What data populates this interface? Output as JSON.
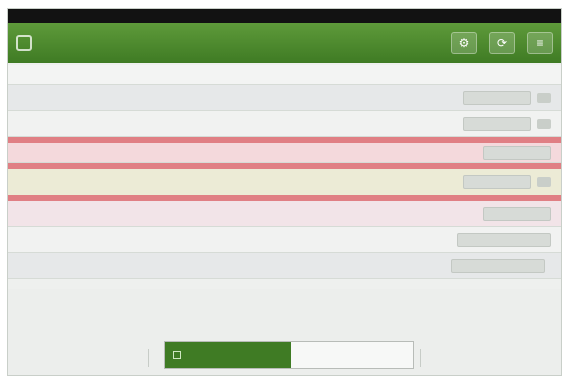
{
  "window": {
    "title": "",
    "app_title": "",
    "icons": {
      "app": "app-icon",
      "settings": "settings-icon",
      "refresh": "refresh-icon",
      "menu": "menu-icon"
    }
  },
  "table": {
    "header": {
      "id": "",
      "name": "",
      "status": ""
    },
    "rows": [
      {
        "id": "",
        "name": "",
        "status": "",
        "style": "alt"
      },
      {
        "id": "",
        "name": "",
        "status": "",
        "style": "plain"
      },
      {
        "id": "",
        "name": "",
        "status": "",
        "style": "highlight-top"
      },
      {
        "id": "",
        "name": "",
        "status": "",
        "style": "highlight"
      },
      {
        "id": "",
        "name": "",
        "status": "",
        "style": "pink"
      },
      {
        "id": "",
        "name": "",
        "status": "",
        "style": "plain"
      },
      {
        "id": "",
        "name": "",
        "status": "",
        "style": "alt"
      }
    ]
  },
  "footer": {
    "primary_label": "",
    "secondary_label": ""
  },
  "colors": {
    "accent_green": "#3f7b24",
    "highlight_border": "#e07f84",
    "titlebar": "#121212"
  }
}
